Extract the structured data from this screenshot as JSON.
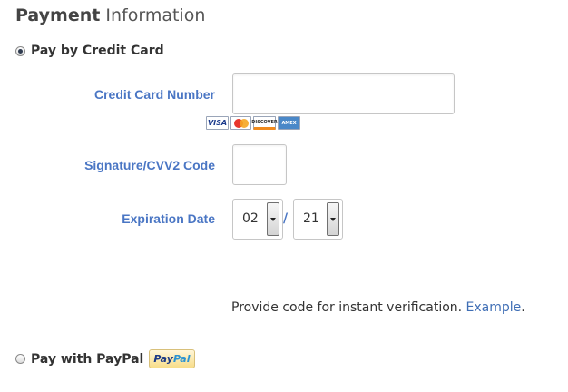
{
  "heading": {
    "strong": "Payment",
    "light": "Information"
  },
  "credit_option": {
    "label": "Pay by Credit Card",
    "selected": true
  },
  "fields": {
    "card_number": {
      "label": "Credit Card Number",
      "value": ""
    },
    "cvv": {
      "label": "Signature/CVV2 Code",
      "value": ""
    },
    "expiration": {
      "label": "Expiration Date",
      "month": "02",
      "separator": "/",
      "year": "21"
    }
  },
  "card_logos": [
    "VISA",
    "MasterCard",
    "DISCOVER",
    "AMEX"
  ],
  "card_logo_text": {
    "visa": "VISA",
    "discover": "DISCOVER",
    "amex": "AMEX"
  },
  "helper": {
    "text": "Provide code for instant verification.",
    "link": "Example",
    "suffix": "."
  },
  "paypal_option": {
    "label": "Pay with PayPal",
    "selected": false,
    "badge_part1": "Pay",
    "badge_part2": "Pal"
  },
  "colors": {
    "label_blue": "#4a76c4",
    "link_blue": "#3f6eb5"
  }
}
